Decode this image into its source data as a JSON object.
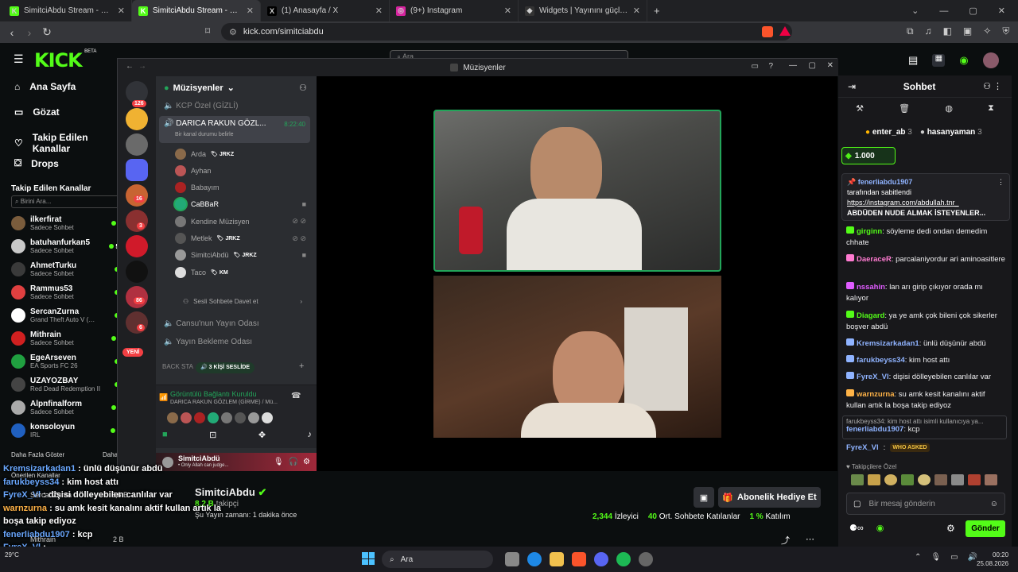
{
  "browser": {
    "tabs": [
      {
        "title": "SimitciAbdu Stream - Watch Live on",
        "icon": "kick-favicon",
        "color": "#53fc18",
        "glyph": "K"
      },
      {
        "title": "SimitciAbdu Stream - Watch Live",
        "icon": "kick-favicon",
        "color": "#53fc18",
        "glyph": "K"
      },
      {
        "title": "(1) Anasayfa / X",
        "icon": "x-favicon",
        "color": "#000000",
        "glyph": "X"
      },
      {
        "title": "(9+) Instagram",
        "icon": "instagram-favicon",
        "color": "#d6249f",
        "glyph": "◎"
      },
      {
        "title": "Widgets | Yayınını güçlendirmek için",
        "icon": "widget-favicon",
        "color": "#333333",
        "glyph": "◆"
      }
    ],
    "url": "kick.com/simitciabdu",
    "new_tab": "+"
  },
  "kick": {
    "logo": "KICK",
    "logo_beta": "BETA",
    "search_placeholder": "Ara",
    "menu": [
      "Ana Sayfa",
      "Gözat",
      "Takip Edilen Kanallar",
      "Drops"
    ],
    "followed_title": "Takip Edilen Kanallar",
    "followed_search": "Birini Ara...",
    "channels": [
      {
        "name": "ilkerfirat",
        "sub": "Sadece Sohbet",
        "count": "7",
        "color": "#7a5c3c"
      },
      {
        "name": "batuhanfurkan5",
        "sub": "Sadece Sohbet",
        "count": "5,",
        "color": "#c9c9c9"
      },
      {
        "name": "AhmetTurku",
        "sub": "Sadece Sohbet",
        "count": "",
        "color": "#3a3a3a"
      },
      {
        "name": "Rammus53",
        "sub": "Sadece Sohbet",
        "count": "",
        "color": "#e04040"
      },
      {
        "name": "SercanZurna",
        "sub": "Grand Theft Auto V (…",
        "count": "",
        "color": "#ffffff"
      },
      {
        "name": "Mithrain",
        "sub": "Sadece Sohbet",
        "count": "2",
        "color": "#d02020"
      },
      {
        "name": "EgeArseven",
        "sub": "EA Sports FC 26",
        "count": "",
        "color": "#20a040"
      },
      {
        "name": "UZAYOZBAY",
        "sub": "Red Dead Redemption II",
        "count": "",
        "color": "#444"
      },
      {
        "name": "Alpnfinalform",
        "sub": "Sadece Sohbet",
        "count": "2",
        "color": "#aaaaaa"
      },
      {
        "name": "konsoloyun",
        "sub": "IRL",
        "count": "L",
        "color": "#2060c0"
      }
    ],
    "show_more": "Daha Fazla Göster",
    "show_more_right": "Daha",
    "suggested": "Önerilen Kanallar",
    "suggested_channels": [
      {
        "name": "SercanZurna",
        "count": "3,6 B"
      },
      {
        "name": "Mithrain",
        "count": "2 B"
      }
    ],
    "streamer": "SimitciAbdu",
    "followers": "8,2 B",
    "followers_label": "takipçi",
    "stream_time_label": "Yayın zamanı: 1 dakika önce",
    "stream_time_prefix": "Şu",
    "viewers": "2,344",
    "viewers_label": "İzleyici",
    "chatters": "40",
    "chatters_label": "Ort. Sohbete Katılanlar",
    "participation": "1 %",
    "participation_label": "Katılım",
    "gift_button": "Abonelik Hediye Et"
  },
  "chat": {
    "title": "Sohbet",
    "top_gifters": [
      {
        "name": "enter_ab",
        "count": "3"
      },
      {
        "name": "hasanyaman",
        "count": "3"
      }
    ],
    "kicks_amount": "1.000",
    "pinned_user": "fenerliabdu1907",
    "pinned_by": "tarafından sabitlendi",
    "pinned_link": "https://instagram.com/abdullah.tnr_",
    "pinned_text": "ABDÜDEN NUDE ALMAK İSTEYENLER...",
    "messages": [
      {
        "user": "girginn",
        "color": "#53fc18",
        "text": "söyleme dedi ondan demedim chhate"
      },
      {
        "user": "DaeraceR",
        "color": "#ff7bd1",
        "text": "parcalaniyordur ari aminoasitlere"
      },
      {
        "user": "nssahin",
        "color": "#e05cff",
        "text": "lan arı girip çıkıyor orada mı kalıyor"
      },
      {
        "user": "Diagard",
        "color": "#53fc18",
        "text": "ya ye amk çok bileni çok sikerler boşver abdü"
      },
      {
        "user": "Kremsizarkadan1",
        "color": "#8fb3ff",
        "text": "ünlü düşünür abdü"
      },
      {
        "user": "farukbeyss34",
        "color": "#8fb3ff",
        "text": "kim host attı"
      },
      {
        "user": "FyreX_Vl",
        "color": "#8fb3ff",
        "text": "dişisi dölleyebilen canlılar var"
      },
      {
        "user": "warnzurna",
        "color": "#ffb347",
        "text": "su amk kesit kanalını aktif kullan artık la boşa takip ediyoz"
      }
    ],
    "reply_to": "farukbeyss34: kim host attı isimli kullanıcıya ya...",
    "reply_user": "fenerliabdu1907",
    "reply_text": "kcp",
    "last_user": "FyreX_Vl",
    "last_emote": "WHO ASKED",
    "followers_only": "Takipçilere Özel",
    "input_placeholder": "Bir mesaj gönderin",
    "send_button": "Gönder"
  },
  "discord": {
    "window_title": "Müzisyenler",
    "server_name": "Müzisyenler",
    "server_badges": [
      "126",
      "16",
      "3",
      "86",
      "6"
    ],
    "new_badge": "YENİ",
    "channels": [
      {
        "name": "KCP Özel (GİZLİ)"
      },
      {
        "name": "DARICA RAKUN GÖZL...",
        "time": "8:22:40",
        "status": "Bir kanal durumu belirle"
      }
    ],
    "voice_users": [
      {
        "name": "Arda",
        "badge": "JRKZ",
        "color": "#8a6a4a"
      },
      {
        "name": "Ayhan",
        "badge": "",
        "color": "#b55"
      },
      {
        "name": "Babayım",
        "badge": "",
        "color": "#a22"
      },
      {
        "name": "CaBBaR",
        "badge": "",
        "color": "#2a7",
        "active": true
      },
      {
        "name": "Kendine Müzisyen",
        "badge": "",
        "color": "#777"
      },
      {
        "name": "Metlek",
        "badge": "JRKZ",
        "color": "#555"
      },
      {
        "name": "SimitciAbdü",
        "badge": "JRKZ",
        "color": "#999"
      },
      {
        "name": "Taco",
        "badge": "KM",
        "color": "#ddd"
      }
    ],
    "invite": "Sesli Sohbete Davet et",
    "other_channels": [
      "Cansu'nun Yayın Odası",
      "Yayın Bekleme Odası"
    ],
    "back_stage": "BACK STA",
    "in_voice": "3 KİŞİ SESLİDE",
    "connected": "Görüntülü Bağlantı Kuruldu",
    "connected_sub": "DARICA RAKUN GÖZLEM (GİRME) / Mü...",
    "me_name": "SimitciAbdü",
    "me_status": "• Only Allah can judge..."
  },
  "overlay_chat": [
    {
      "user": "Kremsizarkadan1",
      "color": "#6aa8ff",
      "text": " : ünlü düşünür abdü"
    },
    {
      "user": "farukbeyss34",
      "color": "#6aa8ff",
      "text": " : kim host attı"
    },
    {
      "user": "FyreX_Vl",
      "color": "#6aa8ff",
      "text": " : dişisi dölleyebilen canlılar var"
    },
    {
      "user": "warnzurna",
      "color": "#ffb347",
      "text": " : su amk kesit kanalını aktif kullan artık la"
    },
    {
      "user": "",
      "color": "#ffffff",
      "text": "boşa takip ediyoz"
    },
    {
      "user": "fenerliabdu1907",
      "color": "#6aa8ff",
      "text": " : kcp"
    },
    {
      "user": "FyreX_Vl",
      "color": "#6aa8ff",
      "text": " :"
    }
  ],
  "taskbar": {
    "search": "Ara",
    "weather": "29°C",
    "time": "00:20",
    "date": "25.08.2026"
  }
}
